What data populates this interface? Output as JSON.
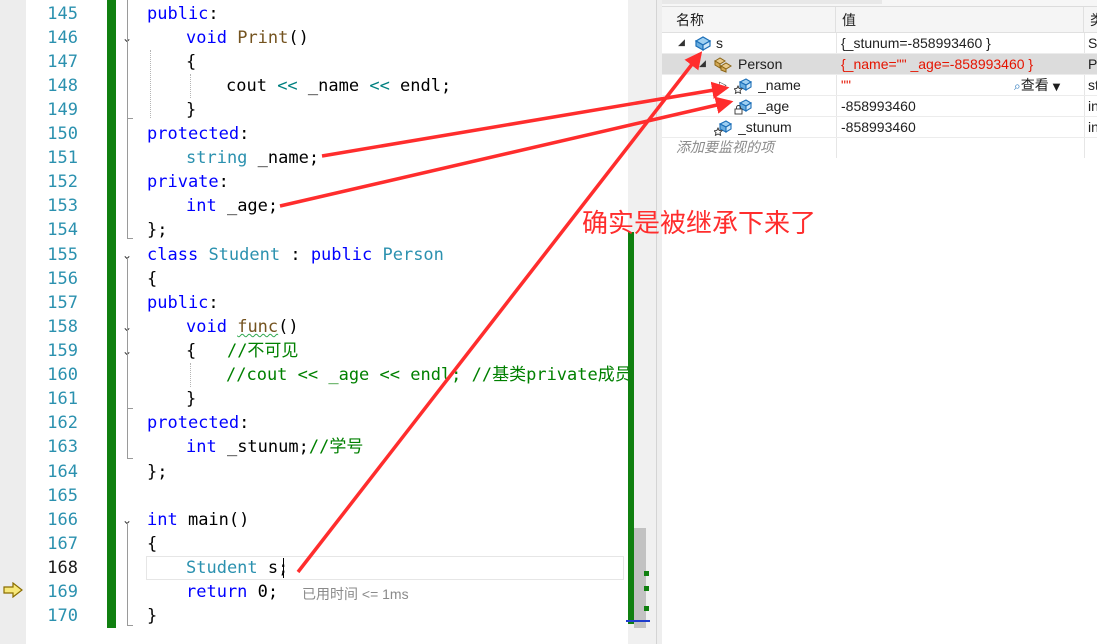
{
  "editor": {
    "first_line": 145,
    "current_line": 168,
    "line_numbers": [
      "145",
      "146",
      "147",
      "148",
      "149",
      "150",
      "151",
      "152",
      "153",
      "154",
      "155",
      "156",
      "157",
      "158",
      "159",
      "160",
      "161",
      "162",
      "163",
      "164",
      "165",
      "166",
      "167",
      "168",
      "169",
      "170"
    ],
    "code": {
      "l145": {
        "kw": "public",
        "p": ":"
      },
      "l146": {
        "kw": "void",
        "fn": "Print",
        "p": "()"
      },
      "l147": {
        "p": "{"
      },
      "l148": {
        "a": "cout ",
        "op1": "<<",
        "b": " _name ",
        "op2": "<<",
        "c": " endl;"
      },
      "l149": {
        "p": "}"
      },
      "l150": {
        "kw": "protected",
        "p": ":"
      },
      "l151": {
        "ty": "string",
        "p": " _name;"
      },
      "l152": {
        "kw": "private",
        "p": ":"
      },
      "l153": {
        "kw": "int",
        "p": " _age;"
      },
      "l154": {
        "p": "};"
      },
      "l155": {
        "kw1": "class",
        "ty1": "Student",
        "s1": " : ",
        "kw2": "public",
        "ty2": "Person"
      },
      "l156": {
        "p": "{"
      },
      "l157": {
        "kw": "public",
        "p": ":"
      },
      "l158": {
        "kw": "void",
        "fn": "func",
        "p": "()"
      },
      "l159": {
        "p": "{   ",
        "cm": "//不可见"
      },
      "l160": {
        "cm": "//cout << _age << endl; //基类private成员"
      },
      "l161": {
        "p": "}"
      },
      "l162": {
        "kw": "protected",
        "p": ":"
      },
      "l163": {
        "kw": "int",
        "p": " _stunum;",
        "cm": "//学号"
      },
      "l164": {
        "p": "};"
      },
      "l166": {
        "kw": "int",
        "p": " main()"
      },
      "l167": {
        "p": "{"
      },
      "l168": {
        "ty": "Student",
        "p": " s;"
      },
      "l169": {
        "kw": "return",
        "p": " 0;"
      },
      "l170": {
        "p": "}"
      }
    },
    "elapsed_hint": "已用时间 <= 1ms"
  },
  "watch": {
    "columns": {
      "name": "名称",
      "value": "值",
      "type": "类"
    },
    "rows": [
      {
        "name": "s",
        "value": "{_stunum=-858993460 }",
        "type": "St",
        "expander": "open"
      },
      {
        "name": "Person",
        "value": "{_name=\"\" _age=-858993460 }",
        "type": "Pe",
        "expander": "open",
        "selected": true
      },
      {
        "name": "_name",
        "value": "\"\"",
        "type": "st",
        "expander": "closed",
        "view_label": "查看"
      },
      {
        "name": "_age",
        "value": "-858993460",
        "type": "in"
      },
      {
        "name": "_stunum",
        "value": "-858993460",
        "type": "in"
      }
    ],
    "add_watch": "添加要监视的项"
  },
  "annotation": "确实是被继承下来了",
  "colors": {
    "keyword": "#0000ff",
    "type": "#2b91af",
    "comment": "#008000",
    "change_bar": "#108010",
    "annotation": "#ff2d2d",
    "value_changed": "#e51400"
  },
  "icons": [
    "fold-chevron-icon",
    "execution-pointer-icon",
    "object-icon",
    "base-class-icon",
    "field-icon",
    "protected-field-icon",
    "private-field-icon",
    "magnifier-icon",
    "dropdown-icon"
  ]
}
